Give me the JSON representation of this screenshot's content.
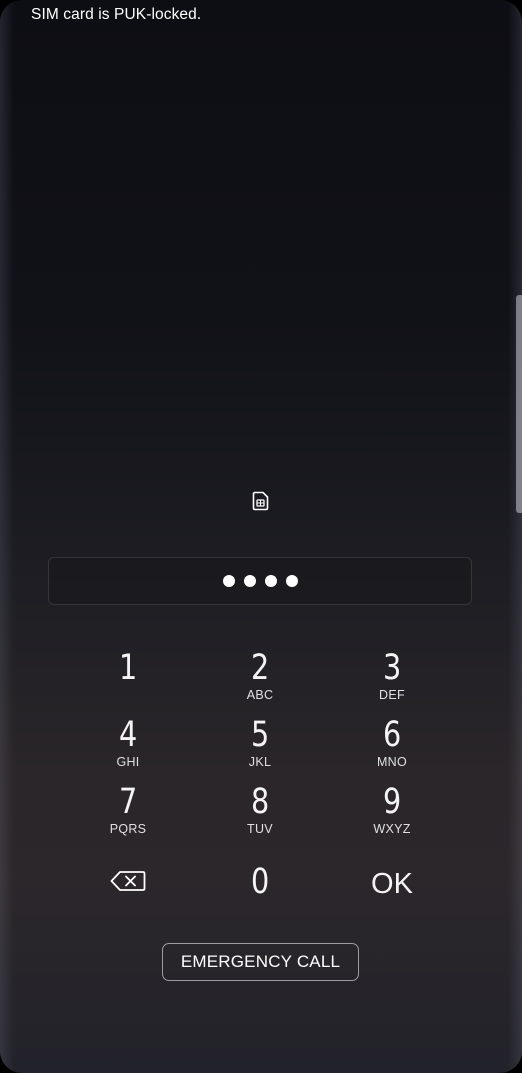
{
  "status": {
    "sim_message": "SIM card is PUK-locked."
  },
  "sim_icon": "sim-card-icon",
  "pin_field": {
    "dot_count": 4
  },
  "keypad": {
    "keys": [
      {
        "digit": "1",
        "letters": ""
      },
      {
        "digit": "2",
        "letters": "ABC"
      },
      {
        "digit": "3",
        "letters": "DEF"
      },
      {
        "digit": "4",
        "letters": "GHI"
      },
      {
        "digit": "5",
        "letters": "JKL"
      },
      {
        "digit": "6",
        "letters": "MNO"
      },
      {
        "digit": "7",
        "letters": "PQRS"
      },
      {
        "digit": "8",
        "letters": "TUV"
      },
      {
        "digit": "9",
        "letters": "WXYZ"
      }
    ],
    "backspace_icon": "backspace-icon",
    "zero": "0",
    "ok": "OK"
  },
  "emergency_call_label": "EMERGENCY CALL",
  "colors": {
    "text": "#ffffff",
    "background_top": "#0d0e13",
    "background_bottom": "#2b272b"
  }
}
